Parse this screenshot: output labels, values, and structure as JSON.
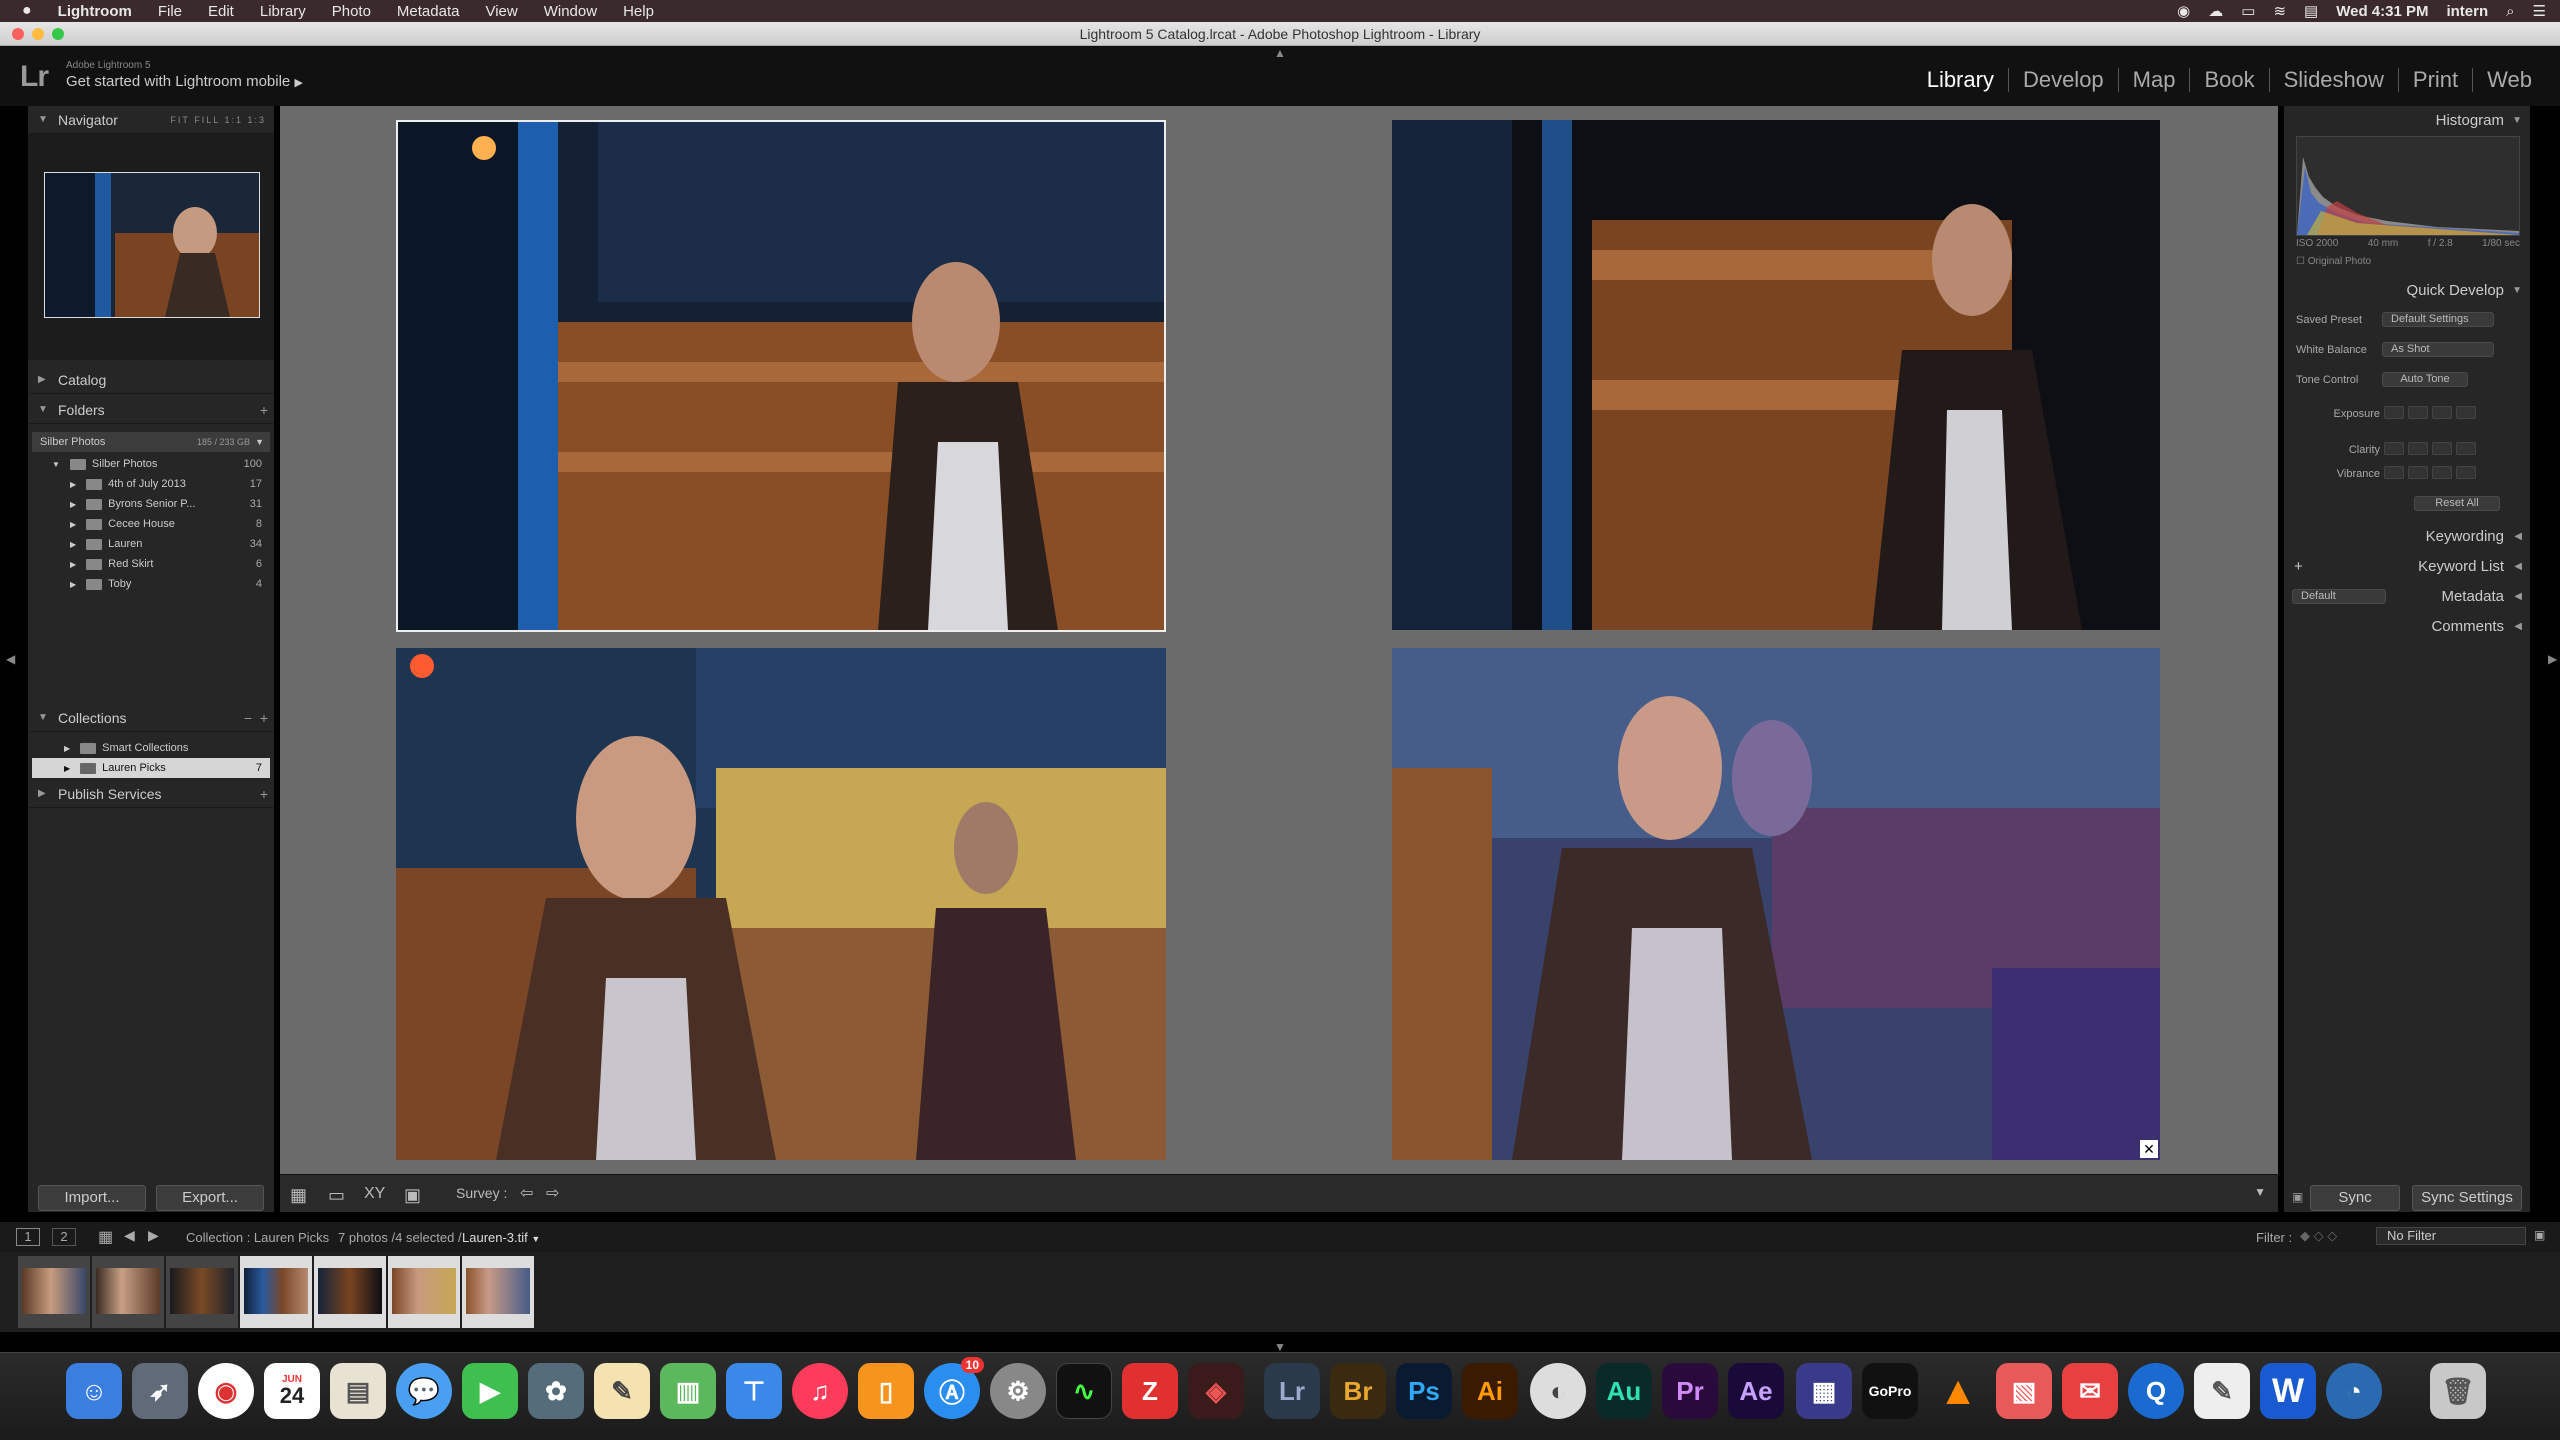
{
  "menubar": {
    "apple": "",
    "app": "Lightroom",
    "items": [
      "File",
      "Edit",
      "Library",
      "Photo",
      "Metadata",
      "View",
      "Window",
      "Help"
    ],
    "clock": "Wed 4:31 PM",
    "user": "intern"
  },
  "window_title": "Lightroom 5 Catalog.lrcat - Adobe Photoshop Lightroom - Library",
  "identity": {
    "logo": "Lr",
    "product": "Adobe Lightroom 5",
    "tagline": "Get started with Lightroom mobile"
  },
  "modules": [
    "Library",
    "Develop",
    "Map",
    "Book",
    "Slideshow",
    "Print",
    "Web"
  ],
  "left": {
    "navigator": {
      "title": "Navigator",
      "zoom": [
        "FIT",
        "FILL",
        "1:1",
        "1:3"
      ]
    },
    "catalog": "Catalog",
    "folders": {
      "title": "Folders",
      "volume": "Silber Photos",
      "volume_size": "185 / 233 GB",
      "root": {
        "name": "Silber Photos",
        "count": "100"
      },
      "items": [
        {
          "name": "4th of July 2013",
          "count": "17"
        },
        {
          "name": "Byrons Senior P...",
          "count": "31"
        },
        {
          "name": "Cecee House",
          "count": "8"
        },
        {
          "name": "Lauren",
          "count": "34"
        },
        {
          "name": "Red Skirt",
          "count": "6"
        },
        {
          "name": "Toby",
          "count": "4"
        }
      ]
    },
    "collections": {
      "title": "Collections",
      "items": [
        {
          "name": "Smart Collections",
          "count": ""
        },
        {
          "name": "Lauren Picks",
          "count": "7"
        }
      ]
    },
    "publish": "Publish Services",
    "import_btn": "Import...",
    "export_btn": "Export..."
  },
  "toolbar": {
    "mode": "Survey :"
  },
  "right": {
    "histogram": {
      "title": "Histogram",
      "iso": "ISO 2000",
      "focal": "40 mm",
      "aperture": "f / 2.8",
      "shutter": "1/80 sec",
      "original": "Original Photo"
    },
    "quick_develop": {
      "title": "Quick Develop",
      "saved_preset_label": "Saved Preset",
      "saved_preset_value": "Default Settings",
      "wb_label": "White Balance",
      "wb_value": "As Shot",
      "tone_label": "Tone Control",
      "auto_tone": "Auto Tone",
      "exposure": "Exposure",
      "clarity": "Clarity",
      "vibrance": "Vibrance",
      "reset": "Reset All"
    },
    "keywording": "Keywording",
    "keyword_list": "Keyword List",
    "metadata": "Metadata",
    "metadata_preset": "Default",
    "comments": "Comments",
    "sync_btn": "Sync",
    "sync_settings_btn": "Sync Settings"
  },
  "filmbar": {
    "page1": "1",
    "page2": "2",
    "source": "Collection : Lauren Picks",
    "selection": "7 photos /4 selected /",
    "filename": "Lauren-3.tif",
    "filter_label": "Filter :",
    "filter_value": "No Filter"
  },
  "dock": {
    "calendar_month": "JUN",
    "calendar_day": "24",
    "appstore_badge": "10",
    "apps": [
      "Lr",
      "Br",
      "Ps",
      "Ai",
      "Au",
      "Pr",
      "Ae",
      "GoPro",
      "W"
    ]
  },
  "colors": {
    "panel": "#262626",
    "grid": "#6b6b6b",
    "menubar": "#3b2a2c",
    "selection": "#dddddd"
  }
}
